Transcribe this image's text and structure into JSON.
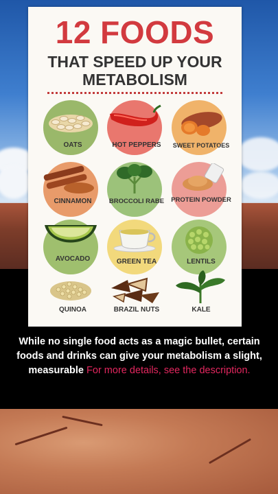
{
  "infographic": {
    "title_line1": "12 FOODS",
    "title_line2": "THAT SPEED UP YOUR",
    "title_line3": "METABOLISM",
    "foods": [
      {
        "label": "OATS",
        "icon": "oats-icon",
        "circle_color": "#9ab86a"
      },
      {
        "label": "HOT PEPPERS",
        "icon": "hot-pepper-icon",
        "circle_color": "#e9776e"
      },
      {
        "label": "SWEET POTATOES",
        "icon": "sweet-potato-icon",
        "circle_color": "#f0b36a"
      },
      {
        "label": "CINNAMON",
        "icon": "cinnamon-icon",
        "circle_color": "#e89b6a"
      },
      {
        "label": "BROCCOLI RABE",
        "icon": "broccoli-rabe-icon",
        "circle_color": "#9cc27a"
      },
      {
        "label": "PROTEIN POWDER",
        "icon": "protein-powder-icon",
        "circle_color": "#ec9d96"
      },
      {
        "label": "AVOCADO",
        "icon": "avocado-icon",
        "circle_color": "#9fbf6e"
      },
      {
        "label": "GREEN TEA",
        "icon": "green-tea-icon",
        "circle_color": "#f2d97c"
      },
      {
        "label": "LENTILS",
        "icon": "lentils-icon",
        "circle_color": "#a6c77a"
      },
      {
        "label": "QUINOA",
        "icon": "quinoa-icon",
        "circle_color": "#fbf9f4"
      },
      {
        "label": "BRAZIL NUTS",
        "icon": "brazil-nuts-icon",
        "circle_color": "#fbf9f4"
      },
      {
        "label": "KALE",
        "icon": "kale-icon",
        "circle_color": "#fbf9f4"
      }
    ]
  },
  "caption": {
    "text": "While no single food acts as a magic bullet, certain foods and drinks can give your metabolism a slight, measurable",
    "more_link": "For more details, see the description."
  }
}
